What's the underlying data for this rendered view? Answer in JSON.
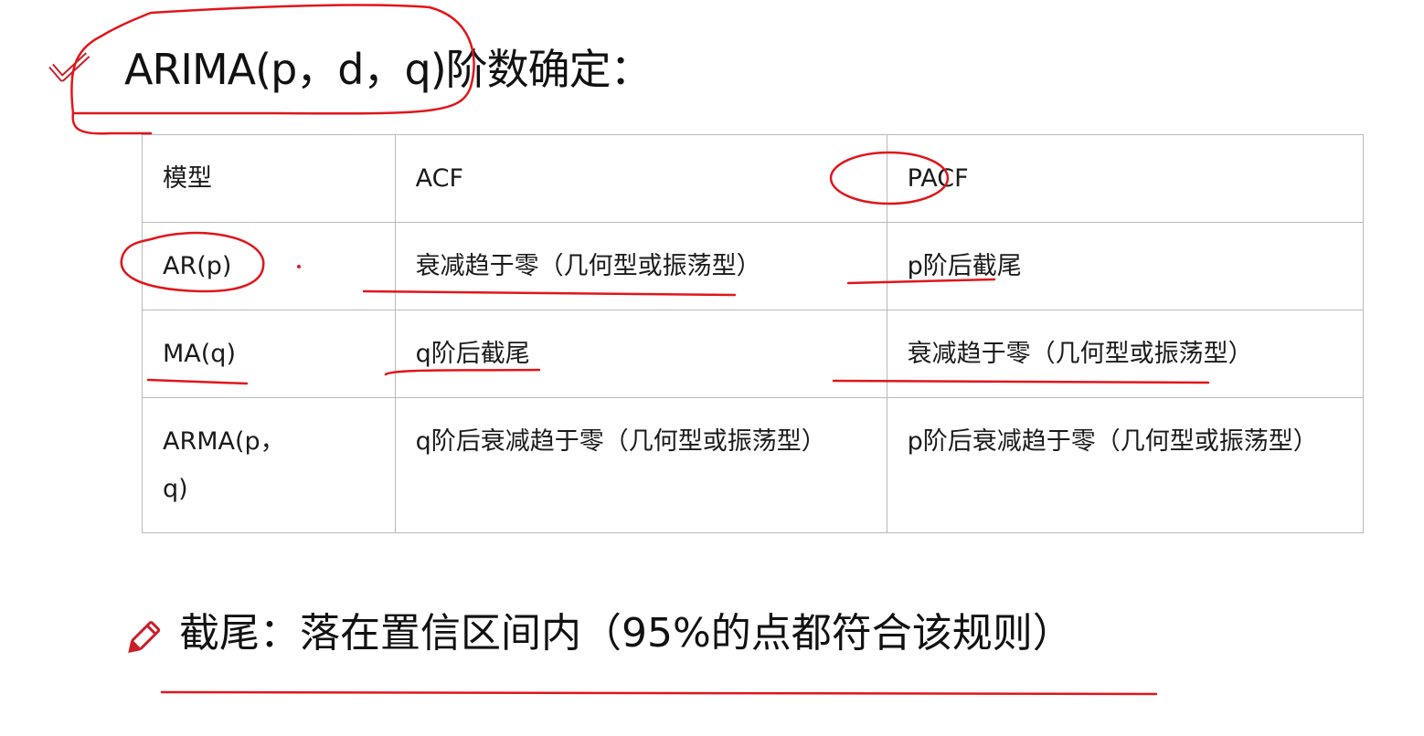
{
  "title": "ARIMA(p，d，q)阶数确定：",
  "table": {
    "headers": [
      "模型",
      "ACF",
      "PACF"
    ],
    "rows": [
      [
        "AR(p)",
        "衰减趋于零（几何型或振荡型）",
        "p阶后截尾"
      ],
      [
        "MA(q)",
        "q阶后截尾",
        "衰减趋于零（几何型或振荡型）"
      ],
      [
        "ARMA(p，q)",
        "q阶后衰减趋于零（几何型或振荡型）",
        "p阶后衰减趋于零（几何型或振荡型）"
      ]
    ]
  },
  "note": "截尾：落在置信区间内（95%的点都符合该规则）",
  "icons": {
    "title": "checkmark-icon",
    "note": "pencil-icon"
  },
  "colors": {
    "annotation": "#e0161b",
    "border": "#b9b9b9",
    "text": "#111111"
  }
}
